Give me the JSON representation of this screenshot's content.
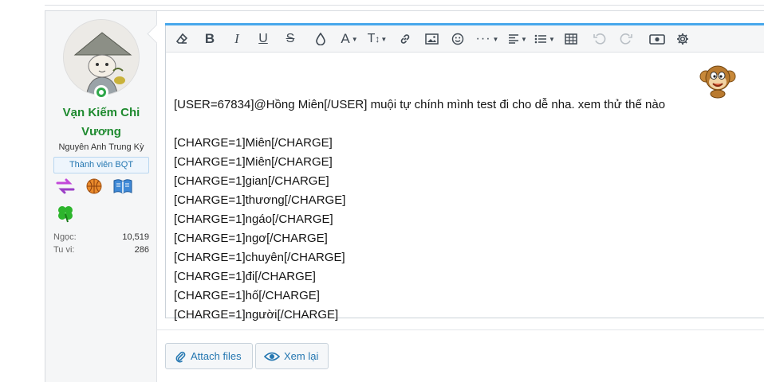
{
  "user": {
    "name": "Vạn Kiếm Chi Vương",
    "title": "Nguyên Anh Trung Kỳ",
    "banner": "Thành viên BQT",
    "stats": [
      {
        "label": "Ngọc:",
        "value": "10,519"
      },
      {
        "label": "Tu vi:",
        "value": "286"
      }
    ]
  },
  "toolbar": {
    "buttons": [
      "eraser-icon",
      "bold-icon",
      "italic-icon",
      "underline-icon",
      "strikethrough-icon",
      "text-color-icon",
      "font-family-icon",
      "font-size-icon",
      "link-icon",
      "image-icon",
      "smilie-icon",
      "more-options-icon",
      "align-icon",
      "list-icon",
      "table-icon",
      "undo-icon",
      "redo-icon",
      "charge-icon",
      "settings-icon"
    ]
  },
  "editor": {
    "lines": [
      "",
      "[USER=67834]@Hồng Miên[/USER]  muội tự chính mình test đi cho dễ nha. xem thử thế nào",
      "",
      "[CHARGE=1]Miên[/CHARGE]",
      "[CHARGE=1]Miên[/CHARGE]",
      "[CHARGE=1]gian[/CHARGE]",
      "[CHARGE=1]thương[/CHARGE]",
      "[CHARGE=1]ngáo[/CHARGE]",
      "[CHARGE=1]ngơ[/CHARGE]",
      "[CHARGE=1]chuyên[/CHARGE]",
      "[CHARGE=1]đi[/CHARGE]",
      "[CHARGE=1]hố[/CHARGE]",
      "[CHARGE=1]người[/CHARGE]"
    ]
  },
  "actions": {
    "attach_label": "Attach files",
    "preview_label": "Xem lại"
  },
  "colors": {
    "username": "#1e8a2f",
    "accent": "#47a7eb",
    "link": "#2577b1"
  }
}
